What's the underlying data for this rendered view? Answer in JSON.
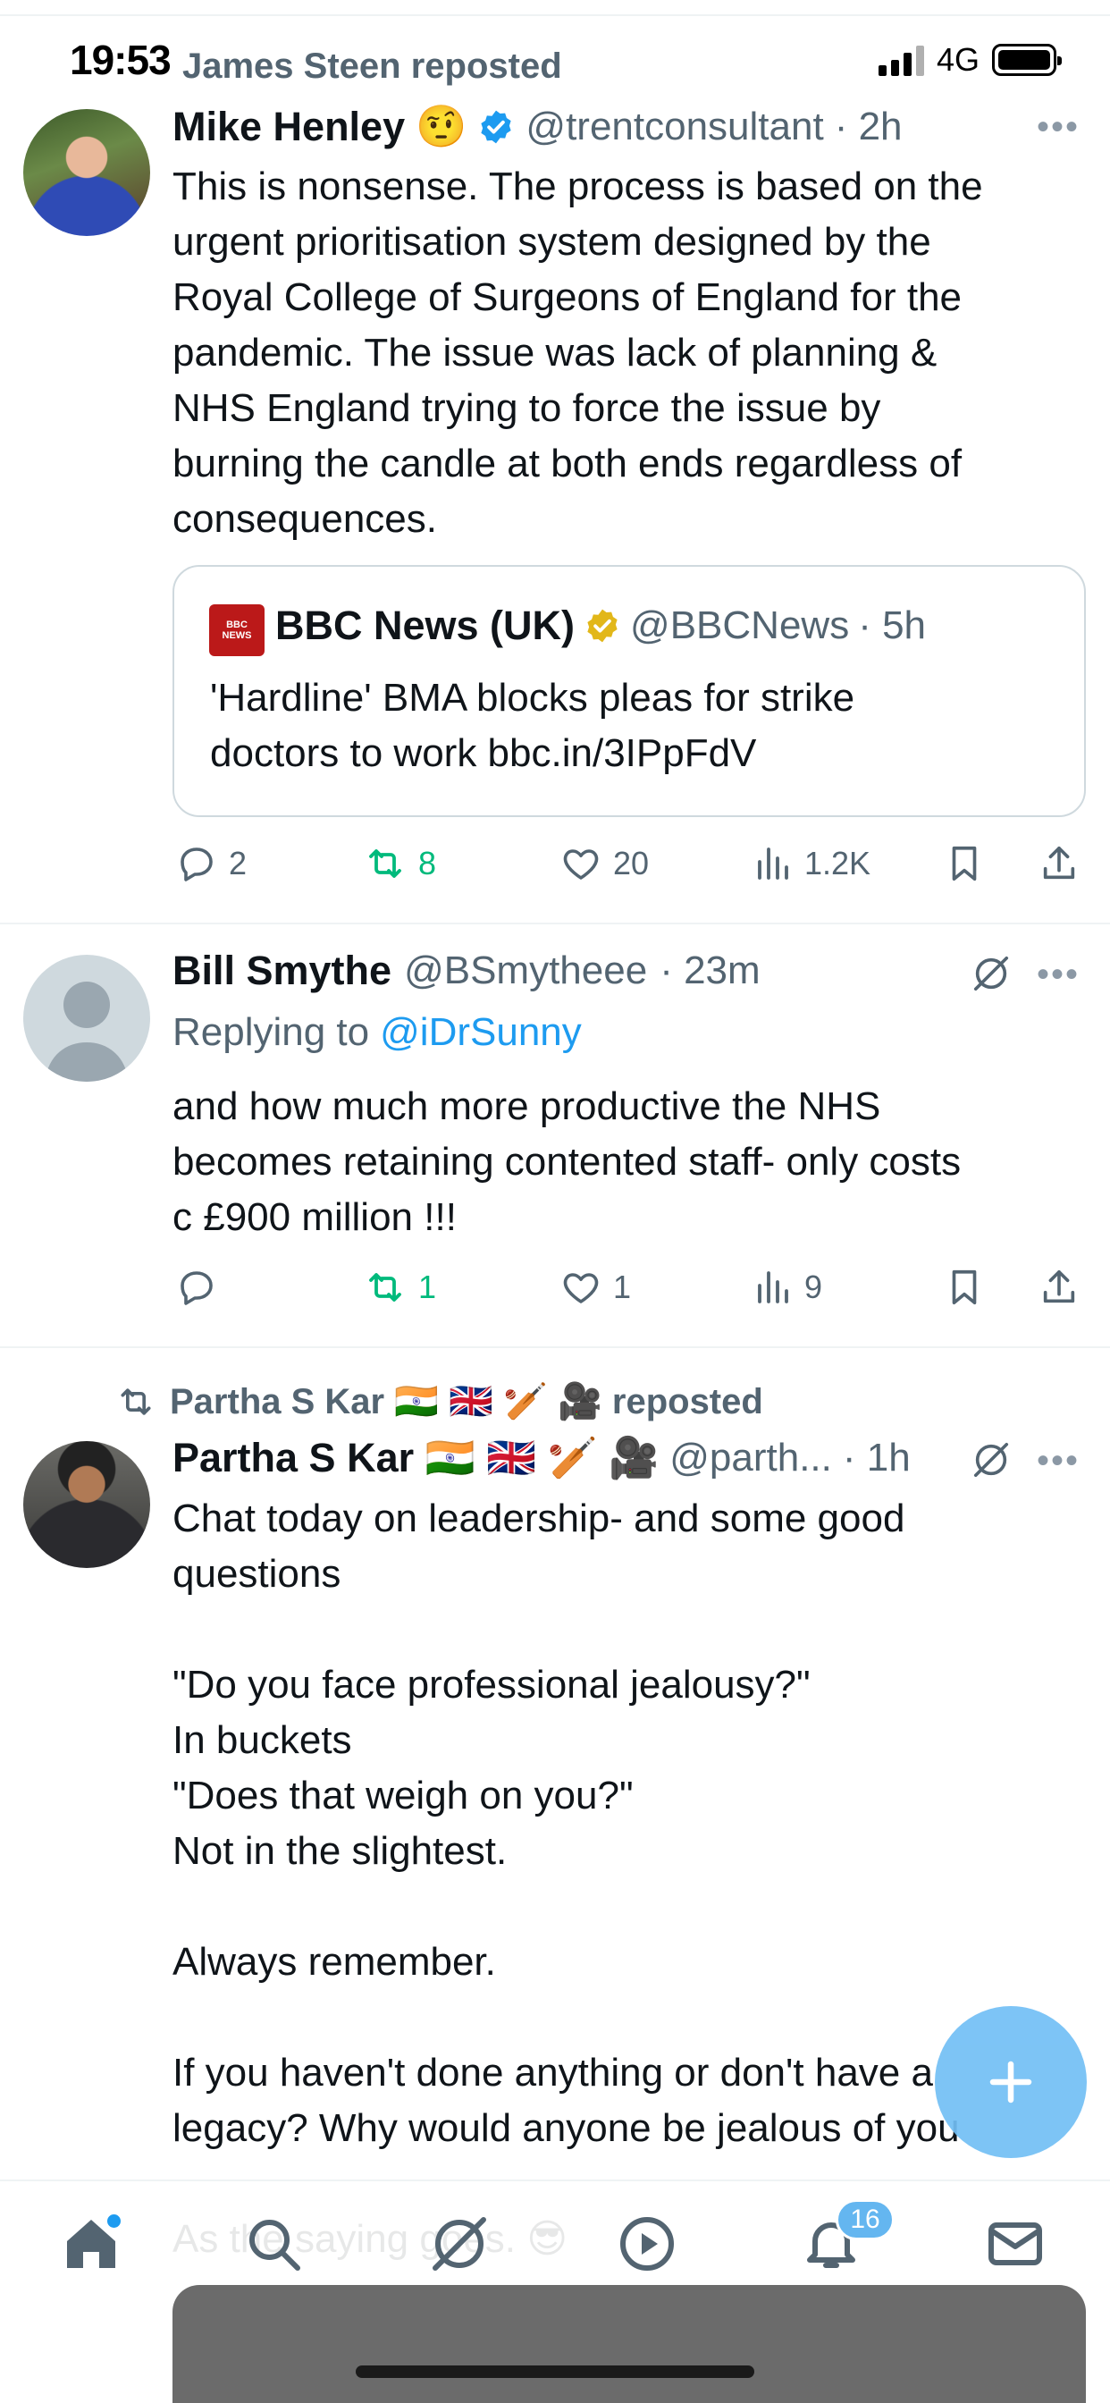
{
  "status_bar": {
    "time": "19:53",
    "network": "4G"
  },
  "tweets": [
    {
      "social_context": "James Steen reposted",
      "name": "Mike Henley",
      "emoji": "🤨",
      "handle": "@trentconsultant",
      "time": "· 2h",
      "body": "This is nonsense. The process is based on the\nurgent prioritisation system designed by the\nRoyal College of Surgeons of England for the\npandemic. The issue was lack of planning &\nNHS England trying to force the issue by\nburning the candle at both ends regardless of\nconsequences.",
      "quote": {
        "logo_text": "BBC NEWS",
        "name": "BBC News (UK)",
        "handle": "@BBCNews",
        "time": "· 5h",
        "body": "'Hardline' BMA blocks pleas for strike\ndoctors to work bbc.in/3IPpFdV"
      },
      "counts": {
        "replies": "2",
        "reposts": "8",
        "likes": "20",
        "views": "1.2K"
      }
    },
    {
      "name": "Bill Smythe",
      "handle": "@BSmytheee",
      "time": "· 23m",
      "replying_prefix": "Replying to",
      "replying_to": "@iDrSunny",
      "body": "and how much more productive the NHS\nbecomes retaining contented staff- only costs\nc £900 million !!!",
      "counts": {
        "replies": "",
        "reposts": "1",
        "likes": "1",
        "views": "9"
      }
    },
    {
      "social_context": "Partha S Kar 🇮🇳 🇬🇧 🏏 🎥 reposted",
      "name": "Partha S Kar 🇮🇳 🇬🇧 🏏 🎥",
      "handle": "@parth...",
      "time": "· 1h",
      "body": "Chat today on leadership- and some good\nquestions\n\n\"Do you face professional jealousy?\"\nIn buckets\n\"Does that weigh on you?\"\nNot in the slightest.\n\nAlways remember.\n\nIf you haven't done anything or don't have a\nlegacy? Why would anyone be jealous of you\n\nAs the saying goes. 😎"
    }
  ],
  "bottom_nav": {
    "notifications_badge": "16"
  },
  "colors": {
    "accent": "#1d9bf0",
    "repost_green": "#00ba7c",
    "fab": "#72bff5"
  }
}
